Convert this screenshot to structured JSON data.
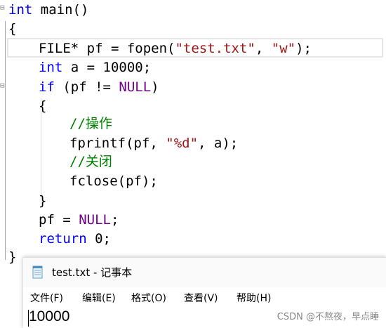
{
  "editor": {
    "lines": [
      {
        "tokens": [
          [
            "kw",
            "int"
          ],
          [
            "plain",
            " main()"
          ]
        ]
      },
      {
        "tokens": [
          [
            "plain",
            "{"
          ]
        ]
      },
      {
        "tokens": [
          [
            "plain",
            "FILE* pf = fopen("
          ],
          [
            "str",
            "\"test.txt\""
          ],
          [
            "plain",
            ", "
          ],
          [
            "str",
            "\"w\""
          ],
          [
            "plain",
            ");"
          ]
        ]
      },
      {
        "tokens": [
          [
            "kw",
            "int"
          ],
          [
            "plain",
            " a = 10000;"
          ]
        ]
      },
      {
        "tokens": [
          [
            "kw",
            "if"
          ],
          [
            "plain",
            " (pf != "
          ],
          [
            "macro",
            "NULL"
          ],
          [
            "plain",
            ")"
          ]
        ]
      },
      {
        "tokens": [
          [
            "plain",
            "{"
          ]
        ]
      },
      {
        "tokens": [
          [
            "cmt",
            "//操作"
          ]
        ]
      },
      {
        "tokens": [
          [
            "plain",
            "fprintf(pf, "
          ],
          [
            "str",
            "\"%d\""
          ],
          [
            "plain",
            ", a);"
          ]
        ]
      },
      {
        "tokens": [
          [
            "cmt",
            "//关闭"
          ]
        ]
      },
      {
        "tokens": [
          [
            "plain",
            "fclose(pf);"
          ]
        ]
      },
      {
        "tokens": [
          [
            "plain",
            "}"
          ]
        ]
      },
      {
        "tokens": [
          [
            "plain",
            "pf = "
          ],
          [
            "macro",
            "NULL"
          ],
          [
            "plain",
            ";"
          ]
        ]
      },
      {
        "tokens": [
          [
            "kw",
            "return"
          ],
          [
            "plain",
            " 0;"
          ]
        ]
      },
      {
        "tokens": [
          [
            "plain",
            "}"
          ]
        ]
      }
    ]
  },
  "notepad": {
    "title": "test.txt - 记事本",
    "menus": [
      "文件(F)",
      "编辑(E)",
      "格式(O)",
      "查看(V)",
      "帮助(H)"
    ],
    "content": "10000"
  },
  "watermark": "CSDN @不熬夜，早点睡"
}
